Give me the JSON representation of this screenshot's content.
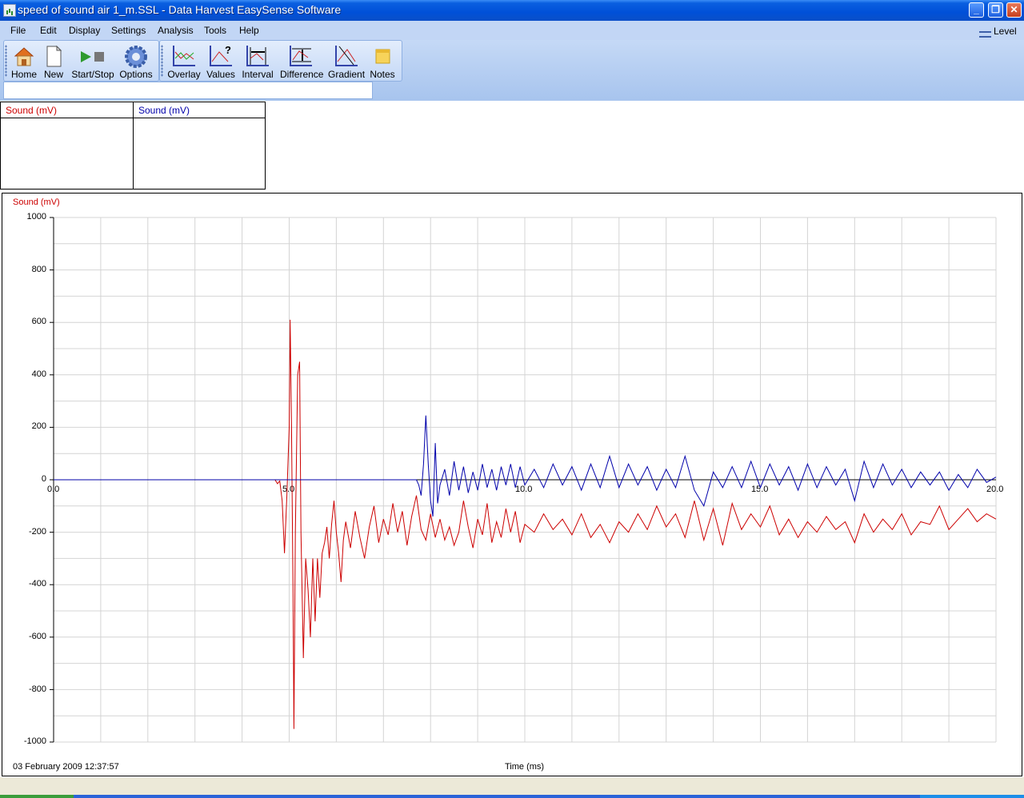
{
  "window": {
    "title": "speed of sound air 1_m.SSL - Data Harvest EasySense Software",
    "buttons": {
      "minimize": "_",
      "restore": "❐",
      "close": "✕"
    }
  },
  "menu": {
    "items": [
      "File",
      "Edit",
      "Display",
      "Settings",
      "Analysis",
      "Tools",
      "Help"
    ],
    "level_label": "Level"
  },
  "toolbar": {
    "home": "Home",
    "new": "New",
    "start_stop": "Start/Stop",
    "options": "Options",
    "overlay": "Overlay",
    "values": "Values",
    "interval": "Interval",
    "difference": "Difference",
    "gradient": "Gradient",
    "notes": "Notes"
  },
  "meters": [
    {
      "label": "Sound (mV)",
      "color": "#cc0000"
    },
    {
      "label": "Sound (mV)",
      "color": "#0000aa"
    }
  ],
  "graph": {
    "y_title": "Sound (mV)",
    "x_title": "Time (ms)",
    "timestamp": "03 February 2009  12:37:57",
    "y_tick_labels": [
      "1000",
      "800",
      "600",
      "400",
      "200",
      "0",
      "-200",
      "-400",
      "-600",
      "-800",
      "-1000"
    ],
    "x_tick_labels": [
      "0.0",
      "5.0",
      "10.0",
      "15.0",
      "20.0"
    ]
  },
  "chart_data": {
    "type": "line",
    "xlabel": "Time (ms)",
    "ylabel": "Sound (mV)",
    "xlim": [
      0,
      20
    ],
    "ylim": [
      -1000,
      1000
    ],
    "grid": true,
    "series": [
      {
        "color": "#cc0000",
        "points": [
          [
            0,
            0
          ],
          [
            1,
            0
          ],
          [
            2,
            0
          ],
          [
            3,
            0
          ],
          [
            4,
            0
          ],
          [
            4.7,
            0
          ],
          [
            4.75,
            -15
          ],
          [
            4.8,
            -5
          ],
          [
            4.85,
            -80
          ],
          [
            4.9,
            -280
          ],
          [
            4.95,
            -60
          ],
          [
            5.0,
            200
          ],
          [
            5.02,
            610
          ],
          [
            5.05,
            200
          ],
          [
            5.08,
            -400
          ],
          [
            5.1,
            -950
          ],
          [
            5.13,
            -200
          ],
          [
            5.18,
            400
          ],
          [
            5.22,
            450
          ],
          [
            5.25,
            -200
          ],
          [
            5.3,
            -680
          ],
          [
            5.35,
            -300
          ],
          [
            5.4,
            -420
          ],
          [
            5.45,
            -600
          ],
          [
            5.5,
            -300
          ],
          [
            5.55,
            -540
          ],
          [
            5.6,
            -300
          ],
          [
            5.65,
            -450
          ],
          [
            5.7,
            -280
          ],
          [
            5.75,
            -240
          ],
          [
            5.8,
            -180
          ],
          [
            5.85,
            -300
          ],
          [
            5.9,
            -170
          ],
          [
            5.95,
            -80
          ],
          [
            6.0,
            -200
          ],
          [
            6.05,
            -280
          ],
          [
            6.1,
            -390
          ],
          [
            6.15,
            -230
          ],
          [
            6.2,
            -160
          ],
          [
            6.3,
            -260
          ],
          [
            6.4,
            -120
          ],
          [
            6.5,
            -220
          ],
          [
            6.6,
            -300
          ],
          [
            6.7,
            -180
          ],
          [
            6.8,
            -100
          ],
          [
            6.9,
            -240
          ],
          [
            7.0,
            -150
          ],
          [
            7.1,
            -210
          ],
          [
            7.2,
            -90
          ],
          [
            7.3,
            -200
          ],
          [
            7.4,
            -120
          ],
          [
            7.5,
            -250
          ],
          [
            7.6,
            -140
          ],
          [
            7.7,
            -60
          ],
          [
            7.8,
            -190
          ],
          [
            7.9,
            -230
          ],
          [
            8.0,
            -130
          ],
          [
            8.1,
            -220
          ],
          [
            8.2,
            -150
          ],
          [
            8.3,
            -230
          ],
          [
            8.4,
            -180
          ],
          [
            8.5,
            -250
          ],
          [
            8.6,
            -200
          ],
          [
            8.7,
            -80
          ],
          [
            8.8,
            -180
          ],
          [
            8.9,
            -260
          ],
          [
            9.0,
            -150
          ],
          [
            9.1,
            -210
          ],
          [
            9.2,
            -90
          ],
          [
            9.3,
            -240
          ],
          [
            9.4,
            -160
          ],
          [
            9.5,
            -220
          ],
          [
            9.6,
            -110
          ],
          [
            9.7,
            -200
          ],
          [
            9.8,
            -120
          ],
          [
            9.9,
            -240
          ],
          [
            10.0,
            -170
          ],
          [
            10.2,
            -200
          ],
          [
            10.4,
            -130
          ],
          [
            10.6,
            -190
          ],
          [
            10.8,
            -150
          ],
          [
            11.0,
            -210
          ],
          [
            11.2,
            -130
          ],
          [
            11.4,
            -220
          ],
          [
            11.6,
            -170
          ],
          [
            11.8,
            -240
          ],
          [
            12.0,
            -160
          ],
          [
            12.2,
            -200
          ],
          [
            12.4,
            -130
          ],
          [
            12.6,
            -190
          ],
          [
            12.8,
            -100
          ],
          [
            13.0,
            -180
          ],
          [
            13.2,
            -130
          ],
          [
            13.4,
            -220
          ],
          [
            13.6,
            -80
          ],
          [
            13.8,
            -230
          ],
          [
            14.0,
            -110
          ],
          [
            14.2,
            -250
          ],
          [
            14.4,
            -90
          ],
          [
            14.6,
            -190
          ],
          [
            14.8,
            -130
          ],
          [
            15.0,
            -180
          ],
          [
            15.2,
            -100
          ],
          [
            15.4,
            -210
          ],
          [
            15.6,
            -150
          ],
          [
            15.8,
            -220
          ],
          [
            16.0,
            -160
          ],
          [
            16.2,
            -200
          ],
          [
            16.4,
            -140
          ],
          [
            16.6,
            -190
          ],
          [
            16.8,
            -160
          ],
          [
            17.0,
            -240
          ],
          [
            17.2,
            -130
          ],
          [
            17.4,
            -200
          ],
          [
            17.6,
            -150
          ],
          [
            17.8,
            -190
          ],
          [
            18.0,
            -130
          ],
          [
            18.2,
            -210
          ],
          [
            18.4,
            -160
          ],
          [
            18.6,
            -170
          ],
          [
            18.8,
            -100
          ],
          [
            19.0,
            -190
          ],
          [
            19.2,
            -150
          ],
          [
            19.4,
            -110
          ],
          [
            19.6,
            -160
          ],
          [
            19.8,
            -130
          ],
          [
            20.0,
            -150
          ]
        ]
      },
      {
        "color": "#0000aa",
        "points": [
          [
            0,
            0
          ],
          [
            2,
            0
          ],
          [
            4,
            0
          ],
          [
            6,
            0
          ],
          [
            7.5,
            0
          ],
          [
            7.7,
            0
          ],
          [
            7.75,
            -20
          ],
          [
            7.8,
            -60
          ],
          [
            7.85,
            60
          ],
          [
            7.9,
            245
          ],
          [
            7.95,
            60
          ],
          [
            8.0,
            -80
          ],
          [
            8.05,
            -140
          ],
          [
            8.1,
            140
          ],
          [
            8.15,
            -90
          ],
          [
            8.2,
            -20
          ],
          [
            8.3,
            40
          ],
          [
            8.4,
            -60
          ],
          [
            8.5,
            70
          ],
          [
            8.6,
            -40
          ],
          [
            8.7,
            50
          ],
          [
            8.8,
            -50
          ],
          [
            8.9,
            30
          ],
          [
            9.0,
            -40
          ],
          [
            9.1,
            60
          ],
          [
            9.2,
            -30
          ],
          [
            9.3,
            40
          ],
          [
            9.4,
            -40
          ],
          [
            9.5,
            50
          ],
          [
            9.6,
            -20
          ],
          [
            9.7,
            60
          ],
          [
            9.8,
            -30
          ],
          [
            9.9,
            50
          ],
          [
            10.0,
            -20
          ],
          [
            10.2,
            40
          ],
          [
            10.4,
            -30
          ],
          [
            10.6,
            60
          ],
          [
            10.8,
            -20
          ],
          [
            11.0,
            50
          ],
          [
            11.2,
            -40
          ],
          [
            11.4,
            60
          ],
          [
            11.6,
            -30
          ],
          [
            11.8,
            90
          ],
          [
            12.0,
            -30
          ],
          [
            12.2,
            60
          ],
          [
            12.4,
            -20
          ],
          [
            12.6,
            50
          ],
          [
            12.8,
            -40
          ],
          [
            13.0,
            40
          ],
          [
            13.2,
            -30
          ],
          [
            13.4,
            90
          ],
          [
            13.6,
            -40
          ],
          [
            13.8,
            -100
          ],
          [
            14.0,
            30
          ],
          [
            14.2,
            -30
          ],
          [
            14.4,
            50
          ],
          [
            14.6,
            -30
          ],
          [
            14.8,
            70
          ],
          [
            15.0,
            -30
          ],
          [
            15.2,
            60
          ],
          [
            15.4,
            -20
          ],
          [
            15.6,
            50
          ],
          [
            15.8,
            -40
          ],
          [
            16.0,
            60
          ],
          [
            16.2,
            -30
          ],
          [
            16.4,
            50
          ],
          [
            16.6,
            -20
          ],
          [
            16.8,
            40
          ],
          [
            17.0,
            -80
          ],
          [
            17.2,
            70
          ],
          [
            17.4,
            -30
          ],
          [
            17.6,
            60
          ],
          [
            17.8,
            -20
          ],
          [
            18.0,
            40
          ],
          [
            18.2,
            -30
          ],
          [
            18.4,
            30
          ],
          [
            18.6,
            -20
          ],
          [
            18.8,
            30
          ],
          [
            19.0,
            -40
          ],
          [
            19.2,
            20
          ],
          [
            19.4,
            -30
          ],
          [
            19.6,
            40
          ],
          [
            19.8,
            -10
          ],
          [
            20.0,
            10
          ]
        ]
      }
    ]
  }
}
